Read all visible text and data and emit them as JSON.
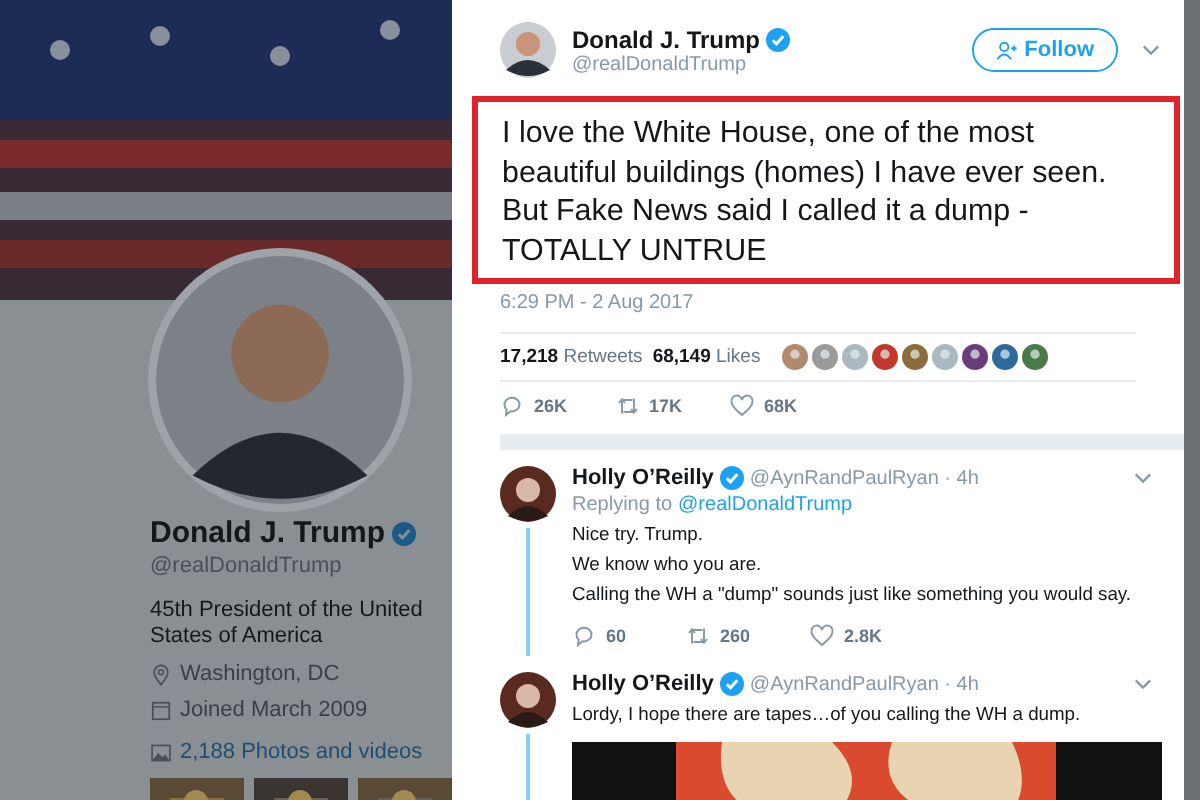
{
  "profile": {
    "name": "Donald J. Trump",
    "verified": true,
    "handle": "@realDonaldTrump",
    "bio": "45th President of the United States of America",
    "location": "Washington, DC",
    "joined": "Joined March 2009",
    "media_link": "2,188 Photos and videos"
  },
  "tweet": {
    "name": "Donald J. Trump",
    "verified": true,
    "handle": "@realDonaldTrump",
    "follow_button": "Follow",
    "text": "I love the White House, one of the most beautiful buildings (homes) I have ever seen. But Fake News said I called it a dump - TOTALLY UNTRUE",
    "time": "6:29 PM - 2 Aug 2017",
    "retweets": {
      "count": "17,218",
      "label": "Retweets"
    },
    "likes": {
      "count": "68,149",
      "label": "Likes"
    },
    "actions": [
      {
        "kind": "reply",
        "count": "26K"
      },
      {
        "kind": "retweet",
        "count": "17K"
      },
      {
        "kind": "like",
        "count": "68K"
      }
    ]
  },
  "replies": [
    {
      "name": "Holly O’Reilly",
      "verified": true,
      "meta": "@AynRandPaulRyan · 4h",
      "replying_label": "Replying to",
      "replying_handle": "@realDonaldTrump",
      "lines": [
        "Nice try. Trump.",
        "We know who you are.",
        "Calling the WH a \"dump\" sounds just like something you would say."
      ],
      "actions": [
        {
          "kind": "reply",
          "count": "60"
        },
        {
          "kind": "retweet",
          "count": "260"
        },
        {
          "kind": "like",
          "count": "2.8K"
        }
      ]
    },
    {
      "name": "Holly O’Reilly",
      "verified": true,
      "meta": "@AynRandPaulRyan · 4h",
      "lines": [
        "Lordy, I hope there are tapes…of you calling the WH a dump."
      ],
      "media": {
        "kind": "picture"
      }
    }
  ]
}
